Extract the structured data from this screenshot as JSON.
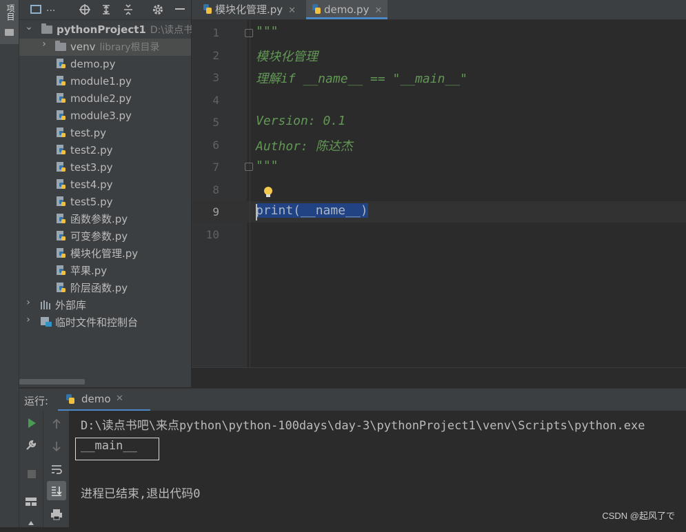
{
  "left_strip": {
    "project_tab_label": "项目"
  },
  "project_panel": {
    "header_title": "...",
    "root": {
      "name": "pythonProject1",
      "path": "D:\\读点书吧"
    },
    "venv": {
      "name": "venv",
      "note": "library根目录"
    },
    "files": [
      "demo.py",
      "module1.py",
      "module2.py",
      "module3.py",
      "test.py",
      "test2.py",
      "test3.py",
      "test4.py",
      "test5.py",
      "函数参数.py",
      "可变参数.py",
      "模块化管理.py",
      "苹果.py",
      "阶层函数.py"
    ],
    "external_libs": "外部库",
    "scratches": "临时文件和控制台"
  },
  "editor": {
    "tabs": [
      {
        "label": "模块化管理.py",
        "active": false
      },
      {
        "label": "demo.py",
        "active": true
      }
    ],
    "line_numbers": [
      "1",
      "2",
      "3",
      "4",
      "5",
      "6",
      "7",
      "8",
      "9",
      "10"
    ],
    "current_line": 9,
    "lines": {
      "l1": "\"\"\"",
      "l2": "模块化管理",
      "l3a": "理解",
      "l3b": "if __name__ == \"__main__\"",
      "l5": "Version: 0.1",
      "l6a": "Author: ",
      "l6b": "陈达杰",
      "l7": "\"\"\"",
      "l9": "print(__name__)"
    }
  },
  "run_panel": {
    "label": "运行:",
    "tab": "demo",
    "console": [
      "D:\\读点书吧\\来点python\\python-100days\\day-3\\pythonProject1\\venv\\Scripts\\python.exe",
      "__main__",
      "进程已结束,退出代码0"
    ]
  },
  "watermark": "CSDN @起风了で",
  "colors": {
    "docstring": "#629755",
    "selection": "#214283",
    "accent": "#4a88c7",
    "run_green": "#499c54"
  }
}
